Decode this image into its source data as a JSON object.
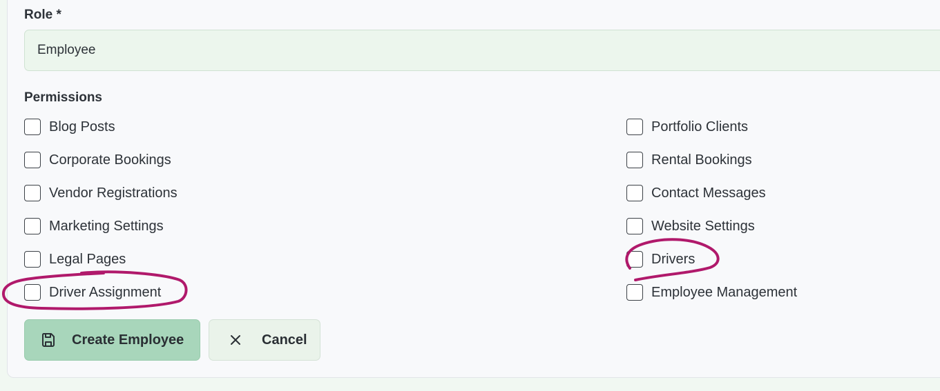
{
  "role": {
    "label": "Role *",
    "value": "Employee"
  },
  "permissions": {
    "label": "Permissions",
    "left": [
      {
        "label": "Blog Posts",
        "checked": false
      },
      {
        "label": "Corporate Bookings",
        "checked": false
      },
      {
        "label": "Vendor Registrations",
        "checked": false
      },
      {
        "label": "Marketing Settings",
        "checked": false
      },
      {
        "label": "Legal Pages",
        "checked": false
      },
      {
        "label": "Driver Assignment",
        "checked": false
      }
    ],
    "right": [
      {
        "label": "Portfolio Clients",
        "checked": false
      },
      {
        "label": "Rental Bookings",
        "checked": false
      },
      {
        "label": "Contact Messages",
        "checked": false
      },
      {
        "label": "Website Settings",
        "checked": false
      },
      {
        "label": "Drivers",
        "checked": false
      },
      {
        "label": "Employee Management",
        "checked": false
      }
    ]
  },
  "actions": {
    "create_label": "Create Employee",
    "create_icon": "save-icon",
    "cancel_label": "Cancel",
    "cancel_icon": "close-icon"
  },
  "annotations": {
    "color": "#b0196b",
    "circled": [
      "Driver Assignment",
      "Drivers"
    ]
  }
}
